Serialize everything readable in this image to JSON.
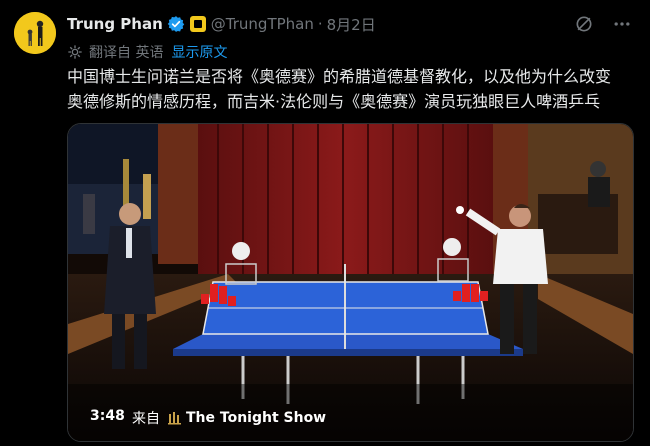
{
  "author": {
    "name": "Trung Phan",
    "handle": "@TrungTPhan",
    "date": "8月2日"
  },
  "translation": {
    "label": "翻译自 英语",
    "show_original": "显示原文"
  },
  "tweet": {
    "line1": "中国博士生问诺兰是否将《奥德赛》的希腊道德基督教化，以及他为什么改变",
    "line2": "奥德修斯的情感历程，而吉米·法伦则与《奥德赛》演员玩独眼巨人啤酒乒乓"
  },
  "media": {
    "duration": "3:48",
    "from_label": "来自",
    "source": "The Tonight Show"
  },
  "icons": [
    "grok-icon",
    "more-icon",
    "verified-badge-icon",
    "brand-badge-icon",
    "translate-icon",
    "tonight-show-logo-icon"
  ],
  "colors": {
    "background": "#000000",
    "text": "#e7e9ea",
    "muted": "#71767b",
    "link": "#1d9bf0",
    "verified": "#1d9bf0",
    "brand_gold": "#f2c81c"
  }
}
